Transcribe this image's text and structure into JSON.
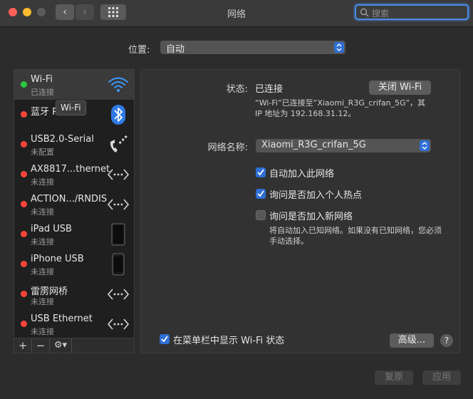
{
  "window": {
    "title": "网络"
  },
  "toolbar": {
    "search_placeholder": "搜索",
    "back": "‹",
    "forward": "›"
  },
  "location": {
    "label": "位置:",
    "value": "自动"
  },
  "services": [
    {
      "name": "Wi-Fi",
      "status": "已连接",
      "state": "green",
      "icon": "wifi-icon",
      "selected": true
    },
    {
      "name": "蓝牙 P",
      "status": "",
      "state": "red",
      "icon": "bluetooth-icon"
    },
    {
      "name": "USB2.0-Serial",
      "status": "未配置",
      "state": "red",
      "icon": "phone-modem-icon"
    },
    {
      "name": "AX8817...thernet",
      "status": "未连接",
      "state": "red",
      "icon": "ethernet-icon"
    },
    {
      "name": "ACTION.../RNDIS",
      "status": "未连接",
      "state": "red",
      "icon": "ethernet-icon"
    },
    {
      "name": "iPad USB",
      "status": "未连接",
      "state": "red",
      "icon": "ipad-icon"
    },
    {
      "name": "iPhone USB",
      "status": "未连接",
      "state": "red",
      "icon": "iphone-icon"
    },
    {
      "name": "雷雳网桥",
      "status": "未连接",
      "state": "red",
      "icon": "ethernet-icon"
    },
    {
      "name": "USB Ethernet",
      "status": "未连接",
      "state": "red",
      "icon": "ethernet-icon"
    }
  ],
  "tooltip": "Wi-Fi",
  "service_bar": {
    "add": "+",
    "remove": "−",
    "gear": "⚙▾"
  },
  "detail": {
    "status_label": "状态:",
    "status_value": "已连接",
    "turn_off_button": "关闭 Wi-Fi",
    "status_desc_1": "“Wi-Fi”已连接至“Xiaomi_R3G_crifan_5G”，其",
    "status_desc_2": "IP 地址为 192.168.31.12。",
    "network_name_label": "网络名称:",
    "network_name_value": "Xiaomi_R3G_crifan_5G",
    "checkboxes": [
      {
        "label": "自动加入此网络",
        "checked": true
      },
      {
        "label": "询问是否加入个人热点",
        "checked": true
      },
      {
        "label": "询问是否加入新网络",
        "checked": false
      }
    ],
    "ask_desc_1": "将自动加入已知网络。如果没有已知网络，您必须",
    "ask_desc_2": "手动选择。",
    "menubar_checkbox_label": "在菜单栏中显示 Wi-Fi 状态",
    "menubar_checkbox_checked": true,
    "advanced_button": "高级...",
    "help": "?"
  },
  "footer": {
    "revert": "复原",
    "apply": "应用"
  },
  "colors": {
    "accent": "#2f6fd6",
    "connected": "#2bc840",
    "disconnected": "#ff453a"
  }
}
